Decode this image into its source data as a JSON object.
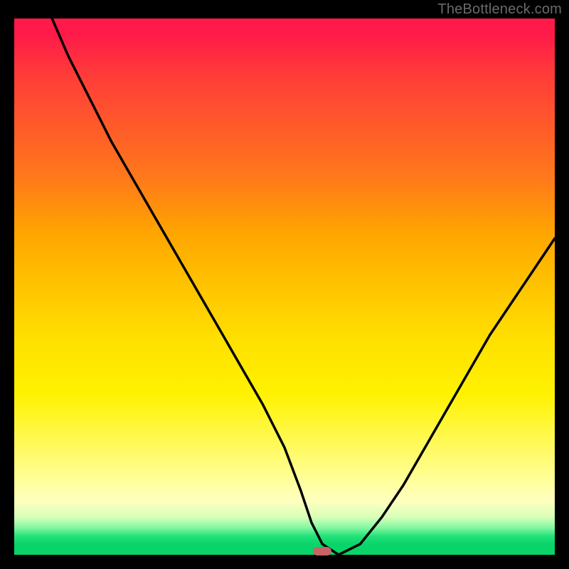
{
  "watermark": "TheBottleneck.com",
  "chart_data": {
    "type": "line",
    "title": "",
    "xlabel": "",
    "ylabel": "",
    "xlim": [
      0,
      100
    ],
    "ylim": [
      0,
      100
    ],
    "series": [
      {
        "name": "curve",
        "x": [
          7,
          10,
          14,
          18,
          22,
          26,
          30,
          34,
          38,
          42,
          46,
          50,
          53,
          55,
          57,
          60,
          64,
          68,
          72,
          76,
          80,
          84,
          88,
          92,
          96,
          100
        ],
        "values": [
          100,
          93,
          85,
          77,
          70,
          63,
          56,
          49,
          42,
          35,
          28,
          20,
          12,
          6,
          2,
          0,
          2,
          7,
          13,
          20,
          27,
          34,
          41,
          47,
          53,
          59
        ]
      }
    ],
    "marker": {
      "x": 57,
      "y": 0
    },
    "background_gradient": {
      "top": "#ff1a49",
      "mid": "#ffe000",
      "bottom": "#09d46a"
    }
  }
}
